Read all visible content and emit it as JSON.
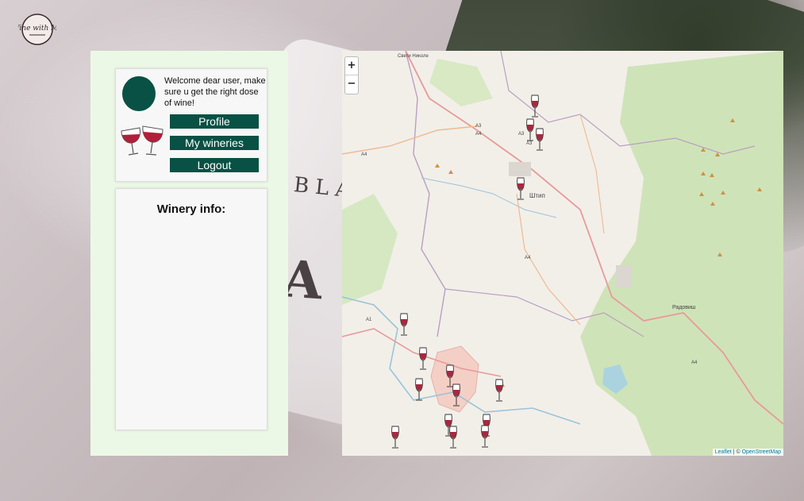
{
  "app": {
    "logo": "wine-with-me-logo",
    "logo_text": "Wine with Me"
  },
  "user_panel": {
    "welcome_text": "Welcome dear user, make sure u get the right dose of wine!",
    "buttons": {
      "profile": "Profile",
      "my_wineries": "My wineries",
      "logout": "Logout"
    }
  },
  "winery_info": {
    "title": "Winery info:"
  },
  "map": {
    "zoom_in": "+",
    "zoom_out": "−",
    "place_labels": {
      "sveti_nikole": "Свети Николе",
      "stip": "Штип",
      "radovis": "Радовиш"
    },
    "road_labels": [
      "A3",
      "A4",
      "A3",
      "A4",
      "A3",
      "A4",
      "A1",
      "A4"
    ],
    "attribution": {
      "leaflet": "Leaflet",
      "separator": " | © ",
      "osm": "OpenStreetMap"
    },
    "marker_icon": "wine-glass-icon"
  },
  "colors": {
    "brand_green": "#085144",
    "panel_bg": "#ecf8e6",
    "wine_red": "#a8283f"
  }
}
